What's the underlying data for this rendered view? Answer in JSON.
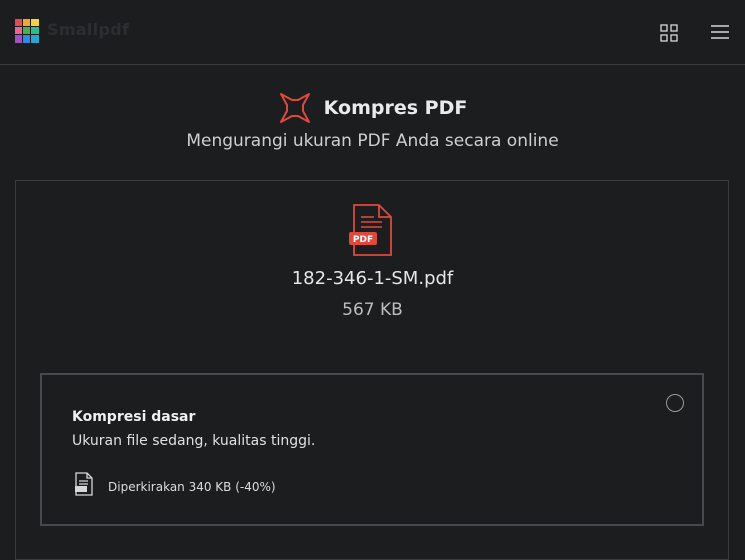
{
  "app": {
    "brand": "Smallpdf",
    "logo_colors": [
      "#e54b4b",
      "#f4a62a",
      "#3fb34f",
      "#2d89ef",
      "#a64dc9",
      "#f06292"
    ]
  },
  "topbar": {
    "grid_icon": "apps-grid-icon",
    "menu_icon": "hamburger-menu-icon"
  },
  "tool": {
    "title": "Kompres PDF",
    "subtitle": "Mengurangi ukuran PDF Anda secara online",
    "accent": "#e0483c"
  },
  "file": {
    "name": "182-346-1-SM.pdf",
    "size": "567 KB",
    "badge": "PDF"
  },
  "option": {
    "title": "Kompresi dasar",
    "description": "Ukuran file sedang, kualitas tinggi.",
    "estimate": "Diperkirakan 340 KB (-40%)",
    "selected": false
  }
}
